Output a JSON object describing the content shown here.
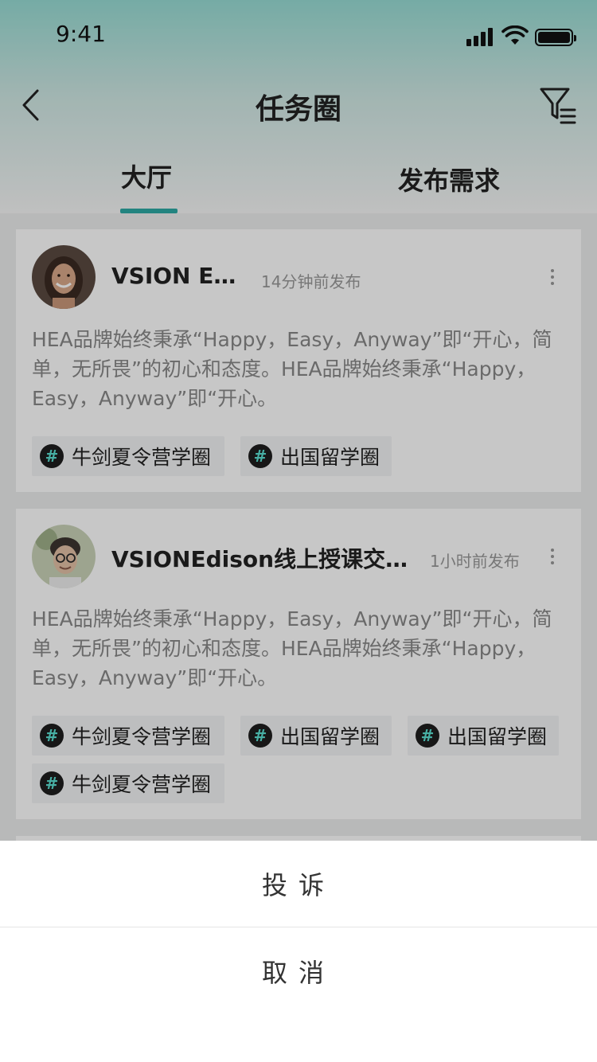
{
  "status_bar": {
    "time": "9:41"
  },
  "nav": {
    "title": "任务圈"
  },
  "tabs": [
    {
      "label": "大厅",
      "active": true
    },
    {
      "label": "发布需求",
      "active": false
    }
  ],
  "posts": [
    {
      "username": "VSION Emily",
      "time": "14分钟前发布",
      "content": "HEA品牌始终秉承“Happy，Easy，Anyway”即“开心，简单，无所畏”的初心和态度。HEA品牌始终秉承“Happy，Easy，Anyway”即“开心。",
      "tags": [
        "牛剑夏令营学圈",
        "出国留学圈"
      ]
    },
    {
      "username": "VSIONEdison线上授课交流…",
      "time": "1小时前发布",
      "content": "HEA品牌始终秉承“Happy，Easy，Anyway”即“开心，简单，无所畏”的初心和态度。HEA品牌始终秉承“Happy，Easy，Anyway”即“开心。",
      "tags": [
        "牛剑夏令营学圈",
        "出国留学圈",
        "出国留学圈",
        "牛剑夏令营学圈"
      ]
    }
  ],
  "tag_symbol": "#",
  "action_sheet": {
    "report_label": "投诉",
    "cancel_label": "取消"
  },
  "colors": {
    "accent": "#2eaaa5",
    "tag_hash": "#5ce0d2",
    "header_top": "#97dcd4"
  }
}
